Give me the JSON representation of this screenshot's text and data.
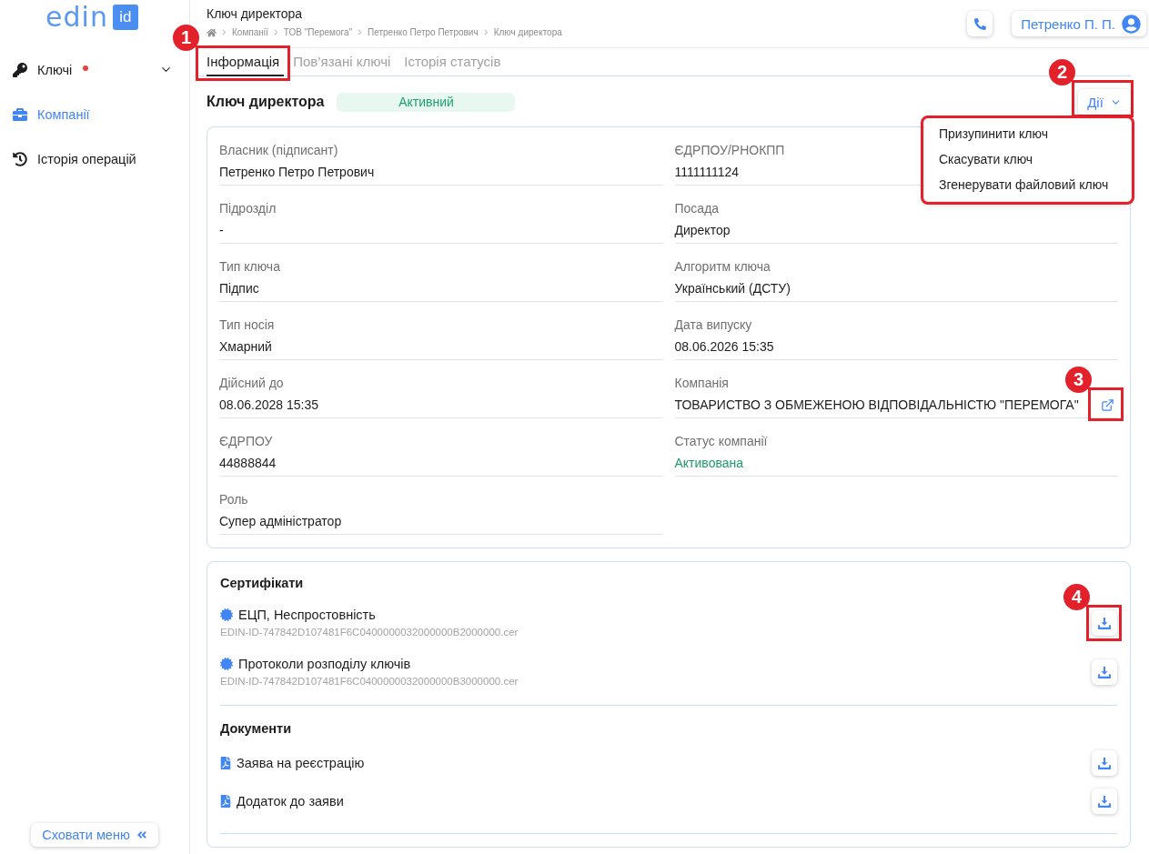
{
  "sidebar": {
    "logo": {
      "word": "edin",
      "badge": "id"
    },
    "items": [
      {
        "label": "Ключі",
        "selected": false,
        "notification": true,
        "expandable": true
      },
      {
        "label": "Компанії",
        "selected": true,
        "notification": false,
        "expandable": false
      },
      {
        "label": "Історія операцій",
        "selected": false,
        "notification": false,
        "expandable": false
      }
    ],
    "collapse_button": "Сховати меню"
  },
  "header": {
    "title": "Ключ директора",
    "breadcrumbs": [
      "Компанії",
      "ТОВ \"Перемога\"",
      "Петренко Петро Петрович",
      "Ключ директора"
    ],
    "user": "Петренко П. П."
  },
  "tabs": [
    {
      "label": "Інформація",
      "selected": true,
      "callout": "1"
    },
    {
      "label": "Пов’язані ключі",
      "selected": false
    },
    {
      "label": "Історія статусів",
      "selected": false
    }
  ],
  "key": {
    "title": "Ключ директора",
    "status": "Активний"
  },
  "actions": {
    "label": "Дії",
    "callout": "2",
    "expanded": true,
    "items": [
      "Призупинити ключ",
      "Скасувати ключ",
      "Згенерувати файловий ключ"
    ]
  },
  "fields": [
    {
      "label": "Власник (підписант)",
      "value": "Петренко Петро Петрович",
      "kind": "text"
    },
    {
      "label": "ЄДРПОУ/РНОКПП",
      "value": "1111111124",
      "kind": "text"
    },
    {
      "label": "Підрозділ",
      "value": "-",
      "kind": "text"
    },
    {
      "label": "Посада",
      "value": "Директор",
      "kind": "text"
    },
    {
      "label": "Тип ключа",
      "value": "Підпис",
      "kind": "text"
    },
    {
      "label": "Алгоритм ключа",
      "value": "Український (ДСТУ)",
      "kind": "text"
    },
    {
      "label": "Тип носія",
      "value": "Хмарний",
      "kind": "text"
    },
    {
      "label": "Дата випуску",
      "value": "08.06.2026 15:35",
      "kind": "text"
    },
    {
      "label": "Дійсний до",
      "value": "08.06.2028 15:35",
      "kind": "text"
    },
    {
      "label": "Компанія",
      "value": "ТОВАРИСТВО З ОБМЕЖЕНОЮ ВІДПОВІДАЛЬНІСТЮ \"ПЕРЕМОГА\"",
      "kind": "with-link",
      "callout": "3"
    },
    {
      "label": "ЄДРПОУ",
      "value": "44888844",
      "kind": "text"
    },
    {
      "label": "Статус компанії",
      "value": "Активована",
      "kind": "status"
    },
    {
      "label": "Роль",
      "value": "Супер адміністратор",
      "kind": "text"
    }
  ],
  "certificates": {
    "title": "Сертифікати",
    "items": [
      {
        "name": "ЕЦП, Неспростовність",
        "file": "EDIN-ID-747842D107481F6C0400000032000000B2000000.cer",
        "callout": "4"
      },
      {
        "name": "Протоколи розподілу ключів",
        "file": "EDIN-ID-747842D107481F6C0400000032000000B3000000.cer"
      }
    ]
  },
  "documents": {
    "title": "Документи",
    "items": [
      {
        "name": "Заява на реєстрацію"
      },
      {
        "name": "Додаток до заяви"
      }
    ]
  }
}
